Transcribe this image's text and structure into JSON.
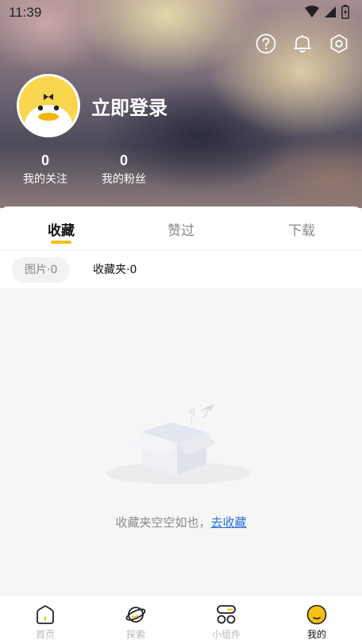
{
  "status_bar": {
    "time": "11:39"
  },
  "header": {
    "login_label": "立即登录",
    "stats": [
      {
        "count": "0",
        "label": "我的关注"
      },
      {
        "count": "0",
        "label": "我的粉丝"
      }
    ]
  },
  "tabs": [
    {
      "label": "收藏",
      "active": true
    },
    {
      "label": "赞过",
      "active": false
    },
    {
      "label": "下载",
      "active": false
    }
  ],
  "subtabs": [
    {
      "label": "图片·0",
      "selected": true
    },
    {
      "label": "收藏夹·0",
      "selected": false
    }
  ],
  "empty_state": {
    "message": "收藏夹空空如也，",
    "link": "去收藏"
  },
  "bottom_nav": [
    {
      "label": "首页",
      "icon": "home-icon"
    },
    {
      "label": "探索",
      "icon": "planet-icon"
    },
    {
      "label": "小组件",
      "icon": "widgets-icon"
    },
    {
      "label": "我的",
      "icon": "profile-icon",
      "active": true
    }
  ],
  "colors": {
    "accent": "#f3c212",
    "link": "#2b6fd6"
  }
}
